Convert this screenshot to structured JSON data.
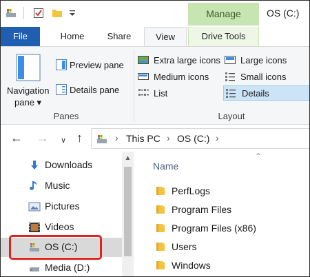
{
  "title_bar": {
    "context_tab": "Manage",
    "window_title": "OS (C:)"
  },
  "ribbon_tabs": [
    "File",
    "Home",
    "Share",
    "View",
    "Drive Tools"
  ],
  "active_tab": "View",
  "ribbon": {
    "panes_group": {
      "label": "Panes",
      "navigation_pane_line1": "Navigation",
      "navigation_pane_line2": "pane",
      "preview_pane": "Preview pane",
      "details_pane": "Details pane"
    },
    "layout_group": {
      "label": "Layout",
      "options": [
        "Extra large icons",
        "Large icons",
        "Medium icons",
        "Small icons",
        "List",
        "Details"
      ],
      "selected": "Details"
    }
  },
  "address_bar": {
    "crumbs": [
      "This PC",
      "OS (C:)"
    ]
  },
  "nav_pane": {
    "items": [
      "Downloads",
      "Music",
      "Pictures",
      "Videos",
      "OS (C:)",
      "Media (D:)"
    ],
    "selected": "OS (C:)"
  },
  "content": {
    "column_header": "Name",
    "files": [
      "PerfLogs",
      "Program Files",
      "Program Files (x86)",
      "Users",
      "Windows"
    ]
  },
  "colors": {
    "file_tab": "#1f5eb0",
    "manage_tab": "#c7e5b0",
    "highlight": "#e0241b",
    "folder": "#f3c43f",
    "selection": "#cce4f7"
  }
}
